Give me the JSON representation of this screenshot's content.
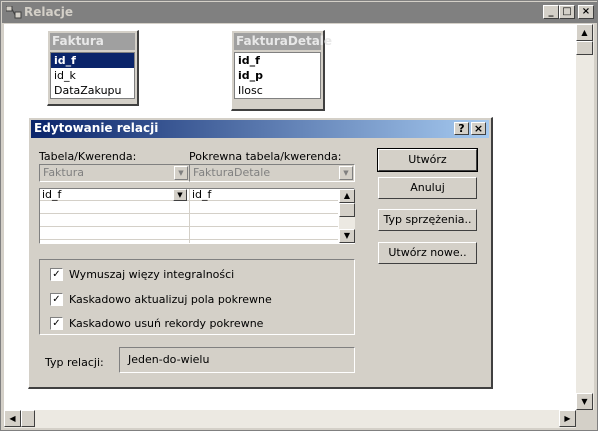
{
  "window": {
    "title": "Relacje",
    "minimize": "_",
    "maximize": "□",
    "close": "×"
  },
  "tables": [
    {
      "name": "Faktura",
      "fields": [
        "id_f",
        "id_k",
        "DataZakupu"
      ]
    },
    {
      "name": "FakturaDetale",
      "fields": [
        "id_f",
        "id_p",
        "Ilosc"
      ]
    }
  ],
  "dialog": {
    "title": "Edytowanie relacji",
    "help_glyph": "?",
    "close_glyph": "×",
    "table_label": "Tabela/Kwerenda:",
    "related_label": "Pokrewna tabela/kwerenda:",
    "table_value": "Faktura",
    "related_value": "FakturaDetale",
    "grid_rows": [
      {
        "left": "id_f",
        "right": "id_f"
      },
      {
        "left": "",
        "right": ""
      },
      {
        "left": "",
        "right": ""
      },
      {
        "left": "",
        "right": ""
      }
    ],
    "buttons": {
      "create": "Utwórz",
      "cancel": "Anuluj",
      "join_type": "Typ sprzężenia..",
      "create_new": "Utwórz nowe.."
    },
    "options": [
      {
        "label": "Wymuszaj więzy integralności",
        "checked": true
      },
      {
        "label": "Kaskadowo aktualizuj pola pokrewne",
        "checked": true
      },
      {
        "label": "Kaskadowo usuń rekordy pokrewne",
        "checked": true
      }
    ],
    "relation_type_label": "Typ relacji:",
    "relation_type_value": "Jeden-do-wielu"
  }
}
